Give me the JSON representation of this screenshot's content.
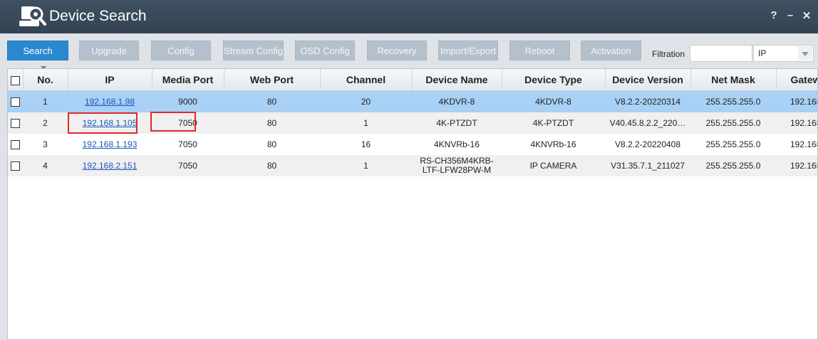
{
  "window": {
    "title": "Device Search",
    "help": "?",
    "minimize": "–",
    "close": "✕"
  },
  "toolbar": {
    "buttons": [
      "Search",
      "Upgrade",
      "Config",
      "Stream Config",
      "OSD Config",
      "Recovery",
      "Import/Export",
      "Reboot",
      "Activation"
    ],
    "filtration_label": "Filtration",
    "filtration_value": "",
    "filtration_type": "IP"
  },
  "table": {
    "headers": [
      "No.",
      "IP",
      "Media Port",
      "Web Port",
      "Channel",
      "Device Name",
      "Device Type",
      "Device Version",
      "Net Mask",
      "Gatew"
    ],
    "rows": [
      [
        "1",
        "192.168.1.98",
        "9000",
        "80",
        "20",
        "4KDVR-8",
        "4KDVR-8",
        "V8.2.2-20220314",
        "255.255.255.0",
        "192.168"
      ],
      [
        "2",
        "192.168.1.105",
        "7050",
        "80",
        "1",
        "4K-PTZDT",
        "4K-PTZDT",
        "V40.45.8.2.2_220…",
        "255.255.255.0",
        "192.168"
      ],
      [
        "3",
        "192.168.1.193",
        "7050",
        "80",
        "16",
        "4KNVRb-16",
        "4KNVRb-16",
        "V8.2.2-20220408",
        "255.255.255.0",
        "192.168"
      ],
      [
        "4",
        "192.168.2.151",
        "7050",
        "80",
        "1",
        "RS-CH356M4KRB-LTF-LFW28PW-M",
        "IP CAMERA",
        "V31.35.7.1_211027",
        "255.255.255.0",
        "192.168"
      ]
    ]
  }
}
